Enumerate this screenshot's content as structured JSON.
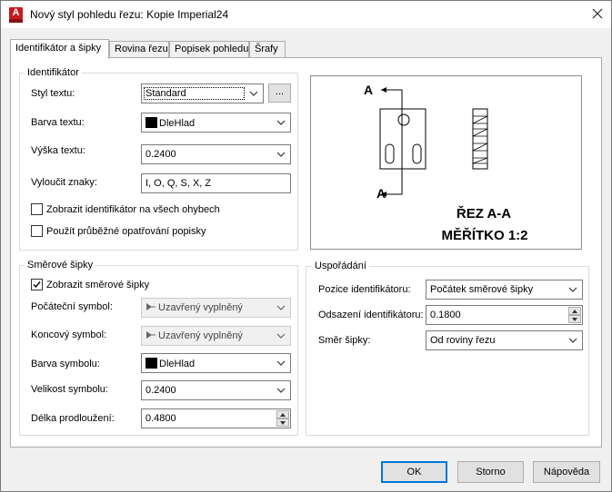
{
  "window": {
    "title": "Nový styl pohledu řezu: Kopie Imperial24",
    "app_icon_letter": "A"
  },
  "tabs": [
    {
      "label": "Identifikátor a šipky",
      "active": true
    },
    {
      "label": "Rovina řezu",
      "active": false
    },
    {
      "label": "Popisek pohledu",
      "active": false
    },
    {
      "label": "Šrafy",
      "active": false
    }
  ],
  "identifier": {
    "legend": "Identifikátor",
    "text_style_label": "Styl textu:",
    "text_style_value": "Standard",
    "ellipsis_label": "...",
    "text_color_label": "Barva textu:",
    "text_color_value": "DleHlad",
    "text_height_label": "Výška textu:",
    "text_height_value": "0.2400",
    "exclude_chars_label": "Vyloučit znaky:",
    "exclude_chars_value": "I, O, Q, S, X, Z",
    "show_all_bends_label": "Zobrazit identifikátor na všech ohybech",
    "show_all_bends_checked": false,
    "continuous_labeling_label": "Použít průběžné opatřování popisky",
    "continuous_labeling_checked": false
  },
  "arrows": {
    "legend": "Směrové šipky",
    "show_arrows_label": "Zobrazit směrové šipky",
    "show_arrows_checked": true,
    "start_symbol_label": "Počáteční symbol:",
    "start_symbol_value": "Uzavřený vyplněný",
    "end_symbol_label": "Koncový symbol:",
    "end_symbol_value": "Uzavřený vyplněný",
    "symbol_color_label": "Barva symbolu:",
    "symbol_color_value": "DleHlad",
    "symbol_size_label": "Velikost symbolu:",
    "symbol_size_value": "0.2400",
    "extension_length_label": "Délka prodloužení:",
    "extension_length_value": "0.4800"
  },
  "preview": {
    "label_top": "A",
    "label_bottom": "A",
    "title_line1": "ŘEZ A-A",
    "title_line2": "MĚŘÍTKO 1:2"
  },
  "arrangement": {
    "legend": "Uspořádání",
    "position_label": "Pozice identifikátoru:",
    "position_value": "Počátek směrové šipky",
    "offset_label": "Odsazení identifikátoru:",
    "offset_value": "0.1800",
    "direction_label": "Směr šipky:",
    "direction_value": "Od roviny řezu"
  },
  "buttons": {
    "ok": "OK",
    "cancel": "Storno",
    "help": "Nápověda"
  },
  "colors": {
    "accent": "#0078d7",
    "app_icon": "#c41a1f"
  }
}
